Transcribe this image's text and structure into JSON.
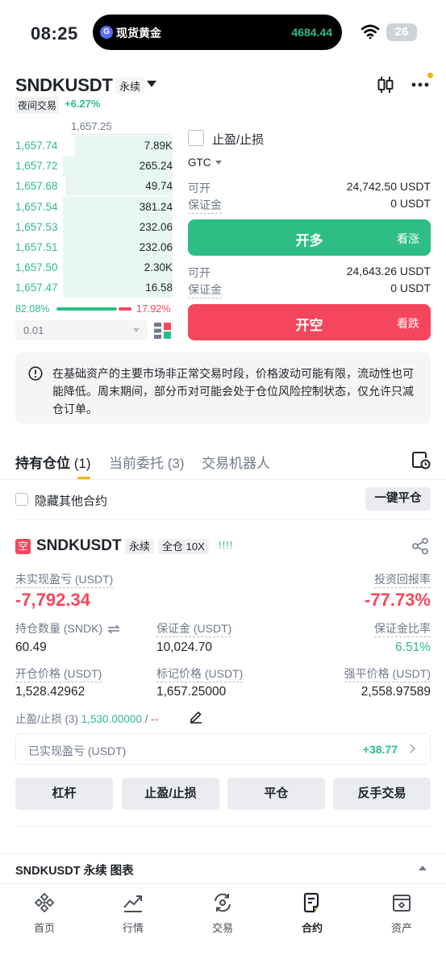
{
  "status_bar": {
    "time": "08:25",
    "island_logo": "G",
    "island_title": "现货黄金",
    "island_price": "4684.44",
    "battery": "26"
  },
  "header": {
    "symbol": "SNDKUSDT",
    "contract_type": "永续",
    "session_tag": "夜间交易",
    "change": "+6.27%"
  },
  "order_book": {
    "last_price": "1,657.25",
    "rows": [
      {
        "price": "1,657.74",
        "qty": "7.89K",
        "depth": 0.62
      },
      {
        "price": "1,657.72",
        "qty": "265.24",
        "depth": 0.7
      },
      {
        "price": "1,657.68",
        "qty": "49.74",
        "depth": 0.68
      },
      {
        "price": "1,657.54",
        "qty": "381.24",
        "depth": 0.7
      },
      {
        "price": "1,657.53",
        "qty": "232.06",
        "depth": 0.7
      },
      {
        "price": "1,657.51",
        "qty": "232.06",
        "depth": 0.7
      },
      {
        "price": "1,657.50",
        "qty": "2.30K",
        "depth": 0.7
      },
      {
        "price": "1,657.47",
        "qty": "16.58",
        "depth": 0.7
      }
    ],
    "buy_ratio": "82.08%",
    "sell_ratio": "17.92%",
    "buy_ratio_value": 0.8208,
    "depth_step": "0.01"
  },
  "order_form": {
    "tpsl_label": "止盈/止损",
    "time_in_force": "GTC",
    "long": {
      "available_label": "可开",
      "available_value": "24,742.50 USDT",
      "margin_label": "保证金",
      "margin_value": "0 USDT",
      "button_label": "开多",
      "button_side": "看涨"
    },
    "short": {
      "available_label": "可开",
      "available_value": "24,643.26 USDT",
      "margin_label": "保证金",
      "margin_value": "0 USDT",
      "button_label": "开空",
      "button_side": "看跌"
    }
  },
  "notice": {
    "text": "在基础资产的主要市场非正常交易时段，价格波动可能有限，流动性也可能降低。周末期间，部分币对可能会处于仓位风险控制状态，仅允许只减仓订单。"
  },
  "tabs": {
    "positions": "持有仓位",
    "positions_count": "(1)",
    "open_orders": "当前委托",
    "open_orders_count": "(3)",
    "bots": "交易机器人"
  },
  "filters": {
    "hide_others": "隐藏其他合约",
    "close_all": "一键平仓"
  },
  "position": {
    "side_tag": "空",
    "symbol": "SNDKUSDT",
    "contract_type": "永续",
    "margin_mode": "全仓 10X",
    "strength": "!!!!",
    "unrealized_pnl_label": "未实现盈亏 (USDT)",
    "unrealized_pnl": "-7,792.34",
    "roe_label": "投资回报率",
    "roe": "-77.73%",
    "size_label": "持仓数量 (SNDK)",
    "size": "60.49",
    "margin_label": "保证金 (USDT)",
    "margin": "10,024.70",
    "margin_ratio_label": "保证金比率",
    "margin_ratio": "6.51%",
    "entry_price_label": "开仓价格 (USDT)",
    "entry_price": "1,528.42962",
    "mark_price_label": "标记价格 (USDT)",
    "mark_price": "1,657.25000",
    "liq_price_label": "强平价格 (USDT)",
    "liq_price": "2,558.97589",
    "tpsl_label": "止盈/止损 (3)",
    "tp_value": "1,530.00000",
    "tpsl_sep": " / ",
    "sl_value": "--",
    "realized_label": "已实现盈亏 (USDT)",
    "realized_value": "+38.77",
    "actions": {
      "leverage": "杠杆",
      "tpsl": "止盈/止损",
      "close": "平仓",
      "reverse": "反手交易"
    }
  },
  "chart_section": {
    "label": "SNDKUSDT 永续 图表"
  },
  "bottom_nav": {
    "home": "首页",
    "markets": "行情",
    "trade": "交易",
    "futures": "合约",
    "assets": "资产"
  },
  "colors": {
    "up": "#2ebd85",
    "down": "#f6465d",
    "accent": "#f0b90b"
  },
  "icons": [
    "wifi-icon",
    "candlestick-icon",
    "more-icon",
    "book-view-icon",
    "info-icon",
    "history-icon",
    "share-icon",
    "edit-icon",
    "chevron-right-icon",
    "home-icon",
    "markets-icon",
    "trade-icon",
    "futures-icon",
    "assets-icon"
  ]
}
